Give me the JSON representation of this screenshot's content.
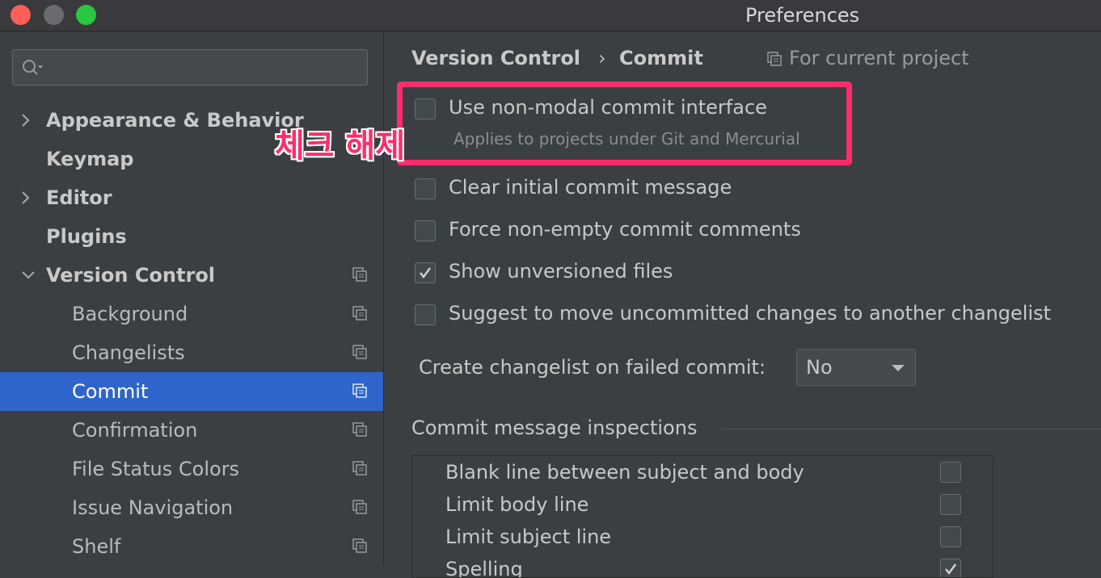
{
  "window": {
    "title": "Preferences"
  },
  "search": {
    "placeholder": ""
  },
  "sidebar": {
    "items": [
      {
        "label": "Appearance & Behavior",
        "level": 0,
        "expandable": true,
        "expanded": false
      },
      {
        "label": "Keymap",
        "level": 0,
        "expandable": false
      },
      {
        "label": "Editor",
        "level": 0,
        "expandable": true,
        "expanded": false
      },
      {
        "label": "Plugins",
        "level": 0,
        "expandable": false
      },
      {
        "label": "Version Control",
        "level": 0,
        "expandable": true,
        "expanded": true
      },
      {
        "label": "Background",
        "level": 1
      },
      {
        "label": "Changelists",
        "level": 1
      },
      {
        "label": "Commit",
        "level": 1,
        "selected": true
      },
      {
        "label": "Confirmation",
        "level": 1
      },
      {
        "label": "File Status Colors",
        "level": 1
      },
      {
        "label": "Issue Navigation",
        "level": 1
      },
      {
        "label": "Shelf",
        "level": 1
      }
    ]
  },
  "breadcrumb": {
    "parent": "Version Control",
    "separator": "›",
    "current": "Commit",
    "scope": "For current project"
  },
  "annotation": {
    "text": "체크 해제",
    "color": "#ff2d6b"
  },
  "options": [
    {
      "label": "Use non-modal commit interface",
      "checked": false,
      "hint": "Applies to projects under Git and Mercurial"
    },
    {
      "label": "Clear initial commit message",
      "checked": false
    },
    {
      "label": "Force non-empty commit comments",
      "checked": false
    },
    {
      "label": "Show unversioned files",
      "checked": true
    },
    {
      "label": "Suggest to move uncommitted changes to another changelist",
      "checked": false
    }
  ],
  "failed_commit": {
    "label": "Create changelist on failed commit:",
    "value": "No"
  },
  "inspections": {
    "title": "Commit message inspections",
    "items": [
      {
        "label": "Blank line between subject and body",
        "checked": false
      },
      {
        "label": "Limit body line",
        "checked": false
      },
      {
        "label": "Limit subject line",
        "checked": false
      },
      {
        "label": "Spelling",
        "checked": true
      }
    ]
  },
  "colors": {
    "selection": "#2f65ca",
    "background": "#3c3f41",
    "highlight": "#ff2d6b"
  }
}
